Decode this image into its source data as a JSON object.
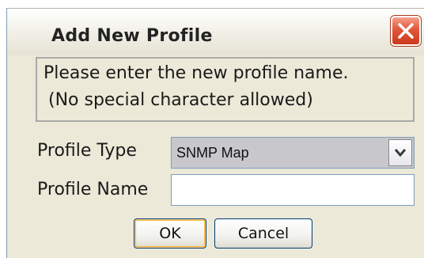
{
  "dialog": {
    "title": "Add New Profile",
    "message_line1": "Please enter the new profile name.",
    "message_line2": "(No special character allowed)"
  },
  "form": {
    "profile_type_label": "Profile Type",
    "profile_type_value": "SNMP Map",
    "profile_name_label": "Profile Name",
    "profile_name_value": ""
  },
  "buttons": {
    "ok": "OK",
    "cancel": "Cancel"
  },
  "icons": {
    "close": "close-icon",
    "dropdown": "chevron-down-icon"
  },
  "colors": {
    "dialog_bg": "#ece9d8",
    "close_red": "#e0573a",
    "select_bg": "#c8c8cc",
    "border_blue": "#7f9db9"
  }
}
